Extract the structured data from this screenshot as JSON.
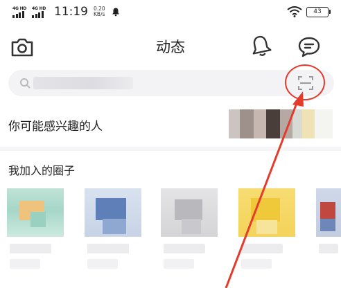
{
  "status_bar": {
    "network_1": "4G HD",
    "network_2": "4G HD",
    "time": "11:19",
    "speed_value": "0.20",
    "speed_unit": "KB/s",
    "battery": "43"
  },
  "header": {
    "title": "动态"
  },
  "search": {
    "placeholder": ""
  },
  "interest_section": {
    "label": "你可能感兴趣的人"
  },
  "circles_section": {
    "label": "我加入的圈子"
  },
  "colors": {
    "annotation_red": "#e53b2c",
    "text": "#222222",
    "search_bg": "#f3f3f5"
  }
}
